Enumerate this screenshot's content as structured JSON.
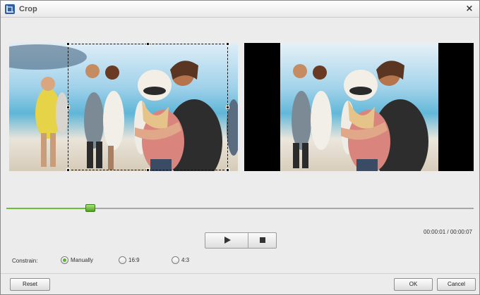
{
  "window": {
    "title": "Crop",
    "close_glyph": "×",
    "icon": "crop-icon"
  },
  "playback": {
    "position_fraction": 0.18,
    "time_readout": "00:00:01 / 00:00:07",
    "play_icon": "play-icon",
    "stop_icon": "stop-icon",
    "accent_color": "#6cbf3a"
  },
  "constrain": {
    "label": "Constrain:",
    "options": [
      {
        "label": "Manually",
        "selected": true
      },
      {
        "label": "16:9",
        "selected": false
      },
      {
        "label": "4:3",
        "selected": false
      }
    ]
  },
  "buttons": {
    "reset": "Reset",
    "ok": "OK",
    "cancel": "Cancel"
  }
}
